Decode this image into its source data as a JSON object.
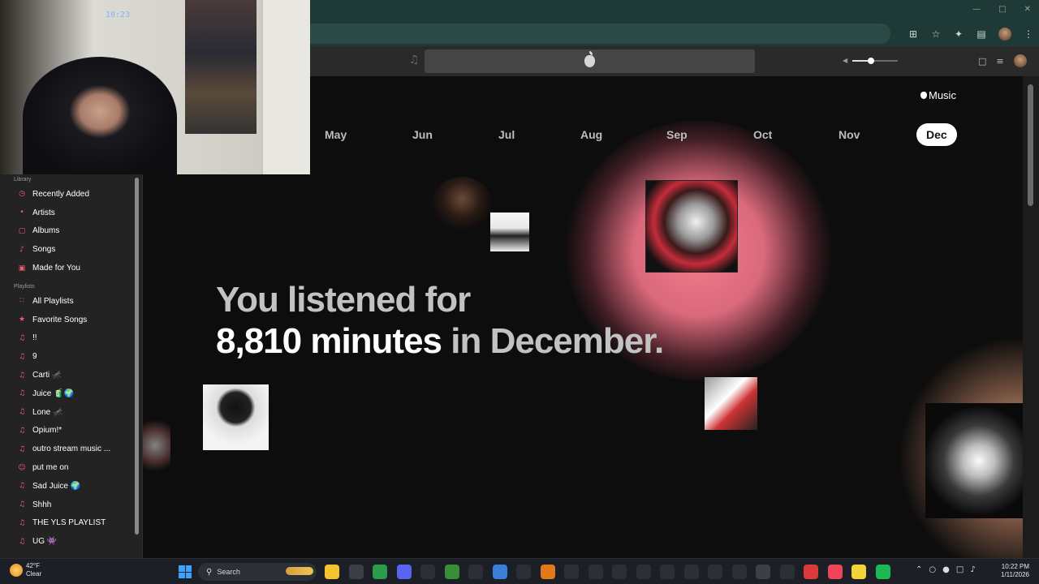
{
  "music_brand": "Music",
  "months": [
    "May",
    "Jun",
    "Jul",
    "Aug",
    "Sep",
    "Oct",
    "Nov",
    "Dec"
  ],
  "active_month": "Dec",
  "headline": {
    "line1": "You listened for",
    "minutes": "8,810 minutes",
    "rest": "in December."
  },
  "volume_level": 0.4,
  "webcam_clock": "10:23",
  "sidebar": {
    "library_label": "Library",
    "library": [
      {
        "label": "Recently Added",
        "icon": "clock-icon"
      },
      {
        "label": "Artists",
        "icon": "microphone-icon"
      },
      {
        "label": "Albums",
        "icon": "album-icon"
      },
      {
        "label": "Songs",
        "icon": "music-note-icon"
      },
      {
        "label": "Made for You",
        "icon": "person-icon"
      }
    ],
    "playlists_label": "Playlists",
    "playlists": [
      {
        "label": "All Playlists",
        "icon": "grid-icon"
      },
      {
        "label": "Favorite Songs",
        "icon": "star-icon"
      },
      {
        "label": "!!",
        "icon": "playlist-icon"
      },
      {
        "label": "9",
        "icon": "playlist-icon"
      },
      {
        "label": "Carti 🦟",
        "icon": "playlist-icon"
      },
      {
        "label": "Juice 🧃🌍",
        "icon": "playlist-icon"
      },
      {
        "label": "Lone 🦟",
        "icon": "playlist-icon"
      },
      {
        "label": "Opium!*",
        "icon": "playlist-icon"
      },
      {
        "label": "outro stream music ...",
        "icon": "playlist-icon"
      },
      {
        "label": "put me on",
        "icon": "people-icon"
      },
      {
        "label": "Sad Juice 🌍",
        "icon": "playlist-icon"
      },
      {
        "label": "Shhh",
        "icon": "playlist-icon"
      },
      {
        "label": "THE YLS PLAYLIST",
        "icon": "playlist-icon"
      },
      {
        "label": "UG 👾",
        "icon": "playlist-icon"
      }
    ]
  },
  "taskbar": {
    "weather_temp": "42°F",
    "weather_desc": "Clear",
    "search_label": "Search",
    "time": "10:22 PM",
    "date": "1/11/2026",
    "app_colors": [
      "#f4c430",
      "#3b3f46",
      "#2a9d4a",
      "#5865f2",
      "#2b2f37",
      "#3a8e3a",
      "#2b2f37",
      "#3a7fd5",
      "#2b2f37",
      "#e07a1a",
      "#2b2f37",
      "#2b2f37",
      "#2b2f37",
      "#2b2f37",
      "#2b2f37",
      "#2b2f37",
      "#2b2f37",
      "#2b2f37",
      "#3a3f48",
      "#2b2f37",
      "#d93a3a",
      "#f0445a",
      "#f2d43a",
      "#1db954"
    ]
  },
  "accent": "#f25c6e"
}
